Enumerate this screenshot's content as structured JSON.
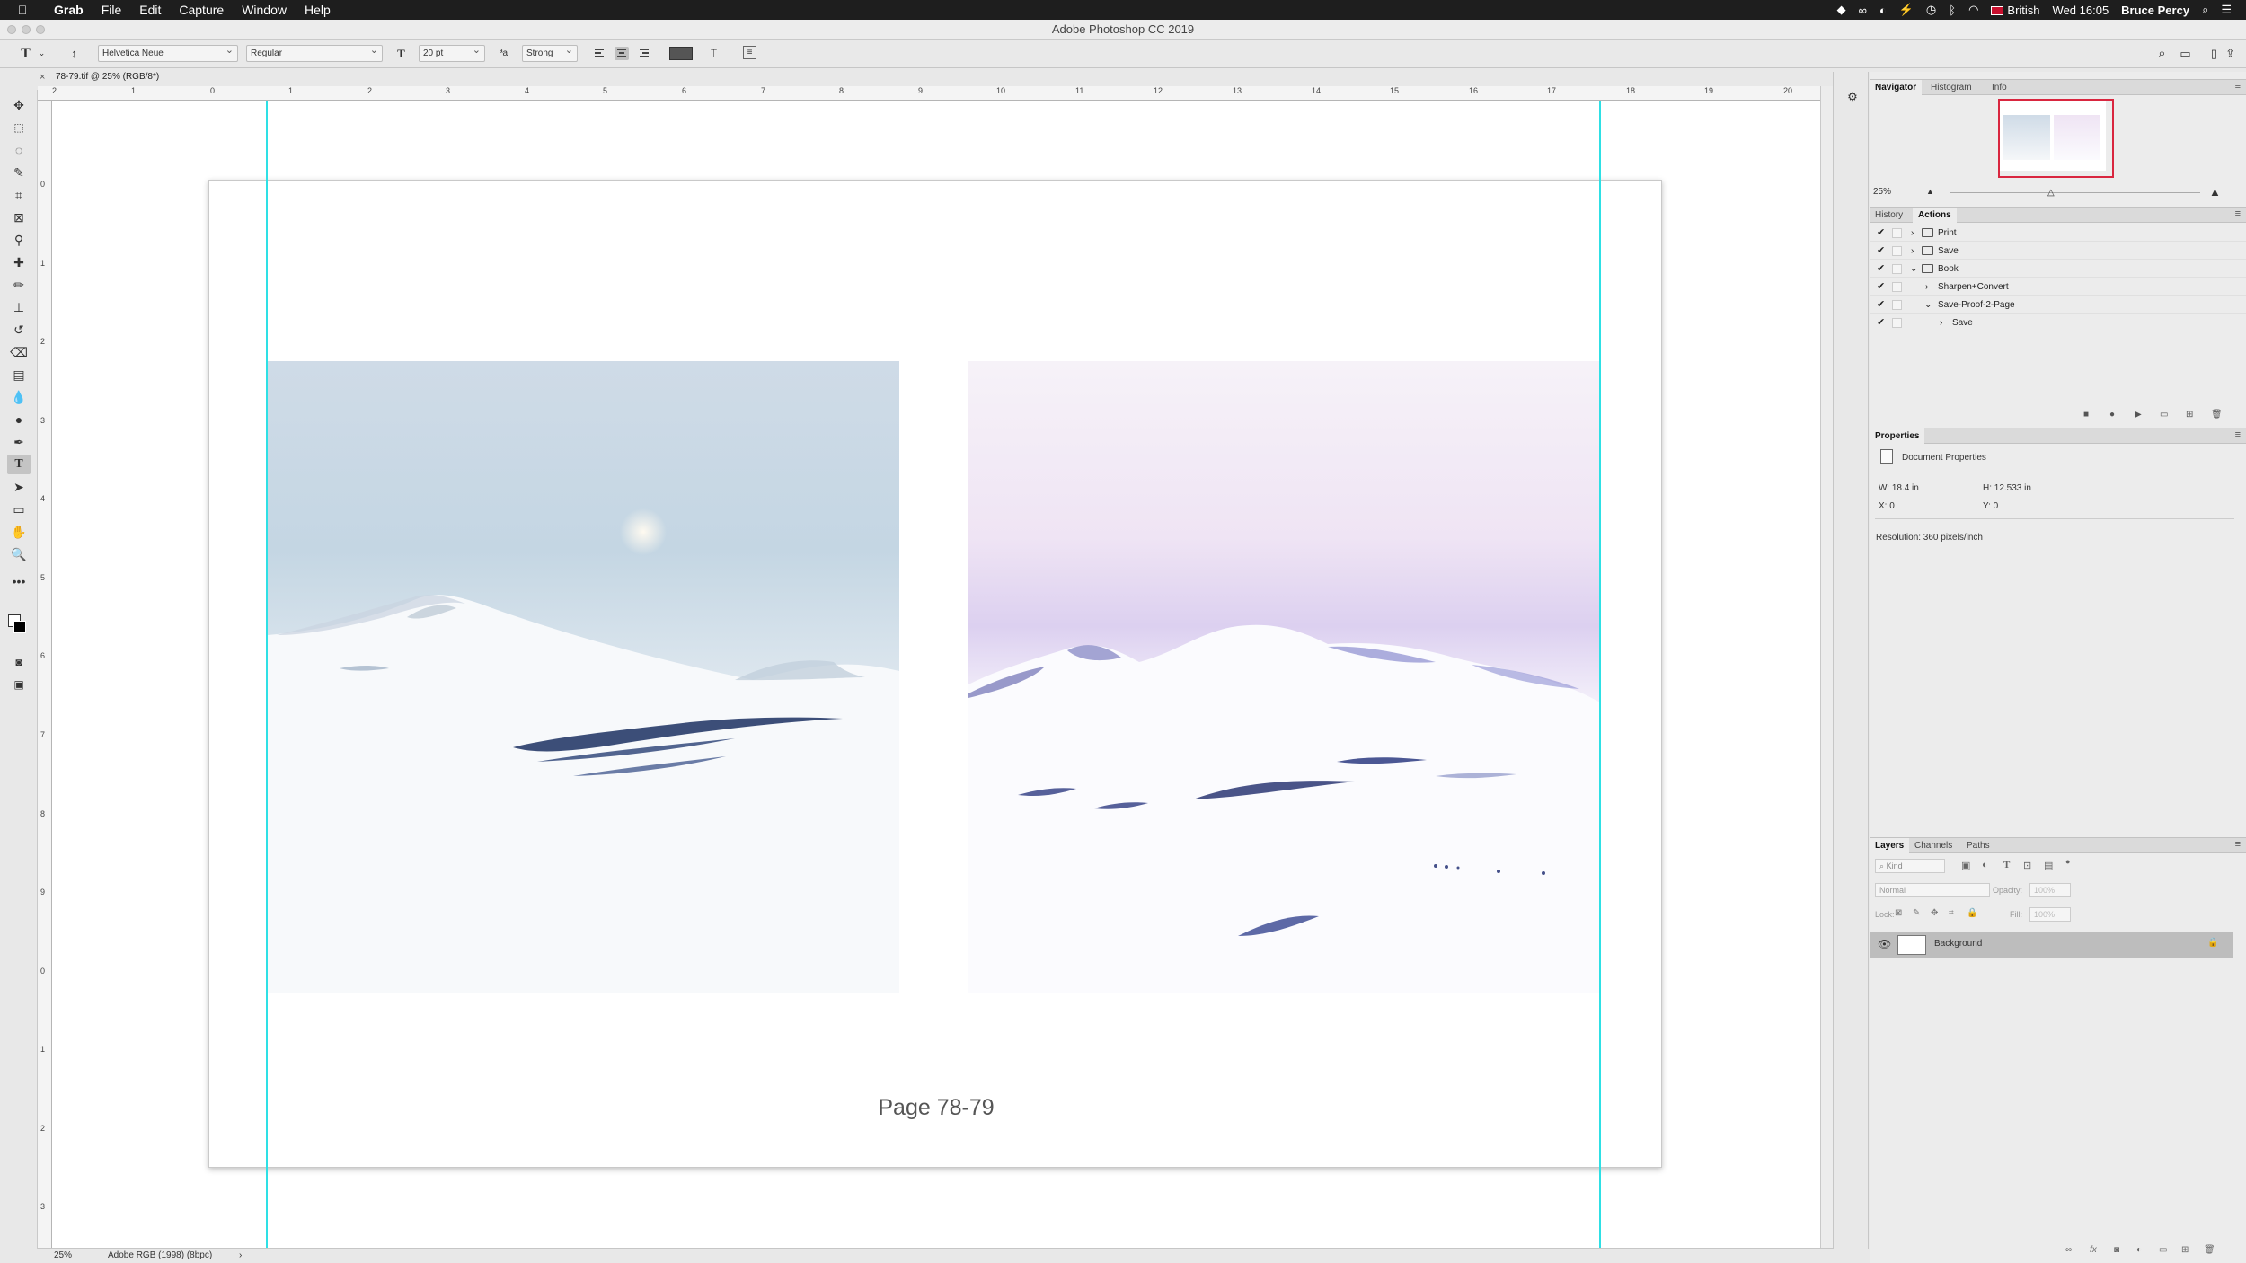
{
  "menubar": {
    "app": "Grab",
    "items": [
      "File",
      "Edit",
      "Capture",
      "Window",
      "Help"
    ],
    "keyboard": "British",
    "clock": "Wed 16:05",
    "user": "Bruce Percy"
  },
  "window": {
    "title": "Adobe Photoshop CC 2019"
  },
  "options_bar": {
    "font_family": "Helvetica Neue",
    "font_style": "Regular",
    "font_size": "20 pt",
    "antialias": "Strong"
  },
  "document": {
    "tab_title": "78-79.tif @ 25% (RGB/8*)",
    "caption": "Page 78-79"
  },
  "rulers": {
    "top": [
      "2",
      "1",
      "0",
      "1",
      "2",
      "3",
      "4",
      "5",
      "6",
      "7",
      "8",
      "9",
      "10",
      "11",
      "12",
      "13",
      "14",
      "15",
      "16",
      "17",
      "18",
      "19",
      "20"
    ],
    "left": [
      "0",
      "1",
      "2",
      "3",
      "4",
      "5",
      "6",
      "7",
      "8",
      "9",
      "0",
      "1",
      "2",
      "3"
    ]
  },
  "status": {
    "zoom": "25%",
    "profile": "Adobe RGB (1998) (8bpc)",
    "arrow": "›"
  },
  "navigator": {
    "tabs": [
      "Navigator",
      "Histogram",
      "Info"
    ],
    "zoom": "25%"
  },
  "actions_panel": {
    "tabs": [
      "History",
      "Actions"
    ],
    "rows": [
      {
        "label": "Print",
        "type": "set",
        "expanded": false
      },
      {
        "label": "Save",
        "type": "set",
        "expanded": false
      },
      {
        "label": "Book",
        "type": "set",
        "expanded": true
      },
      {
        "label": "Sharpen+Convert",
        "type": "action",
        "expanded": false
      },
      {
        "label": "Save-Proof-2-Page",
        "type": "action",
        "expanded": true
      },
      {
        "label": "Save",
        "type": "step",
        "expanded": false
      }
    ]
  },
  "properties": {
    "title": "Properties",
    "doc_label": "Document Properties",
    "w": "W: 18.4 in",
    "h": "H: 12.533 in",
    "x": "X: 0",
    "y": "Y: 0",
    "resolution": "Resolution: 360 pixels/inch"
  },
  "layers": {
    "tabs": [
      "Layers",
      "Channels",
      "Paths"
    ],
    "kind": "Kind",
    "blend": "Normal",
    "opacity_label": "Opacity:",
    "opacity": "100%",
    "lock_label": "Lock:",
    "fill_label": "Fill:",
    "fill": "100%",
    "items": [
      {
        "name": "Background",
        "visible": true,
        "locked": true
      }
    ]
  },
  "colors": {
    "guide": "#2ee0e5",
    "nav_frame": "#d9263f",
    "photo_left_sky": "#c4d6e3",
    "photo_right_sky": "#dcd0f0"
  }
}
